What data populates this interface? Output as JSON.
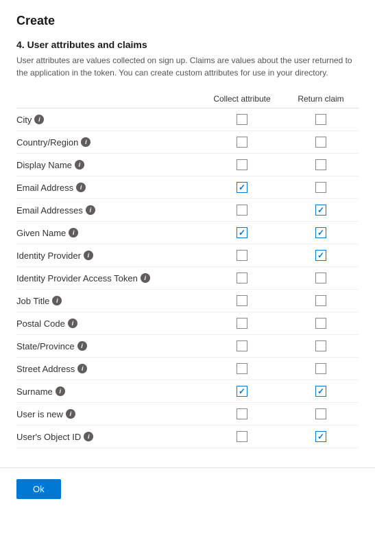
{
  "page": {
    "title": "Create",
    "section_number": "4. User attributes and claims",
    "section_desc": "User attributes are values collected on sign up. Claims are values about the user returned to the application in the token. You can create custom attributes for use in your directory.",
    "header": {
      "collect_label": "Collect attribute",
      "return_label": "Return claim"
    },
    "rows": [
      {
        "id": "city",
        "label": "City",
        "collect": false,
        "return": false
      },
      {
        "id": "country_region",
        "label": "Country/Region",
        "collect": false,
        "return": false
      },
      {
        "id": "display_name",
        "label": "Display Name",
        "collect": false,
        "return": false
      },
      {
        "id": "email_address",
        "label": "Email Address",
        "collect": true,
        "return": false
      },
      {
        "id": "email_addresses",
        "label": "Email Addresses",
        "collect": false,
        "return": true
      },
      {
        "id": "given_name",
        "label": "Given Name",
        "collect": true,
        "return": true
      },
      {
        "id": "identity_provider",
        "label": "Identity Provider",
        "collect": false,
        "return": true
      },
      {
        "id": "identity_provider_access_token",
        "label": "Identity Provider Access Token",
        "collect": false,
        "return": false
      },
      {
        "id": "job_title",
        "label": "Job Title",
        "collect": false,
        "return": false
      },
      {
        "id": "postal_code",
        "label": "Postal Code",
        "collect": false,
        "return": false
      },
      {
        "id": "state_province",
        "label": "State/Province",
        "collect": false,
        "return": false
      },
      {
        "id": "street_address",
        "label": "Street Address",
        "collect": false,
        "return": false
      },
      {
        "id": "surname",
        "label": "Surname",
        "collect": true,
        "return": true
      },
      {
        "id": "user_is_new",
        "label": "User is new",
        "collect": false,
        "return": false
      },
      {
        "id": "users_object_id",
        "label": "User's Object ID",
        "collect": false,
        "return": true
      }
    ],
    "ok_button_label": "Ok"
  }
}
